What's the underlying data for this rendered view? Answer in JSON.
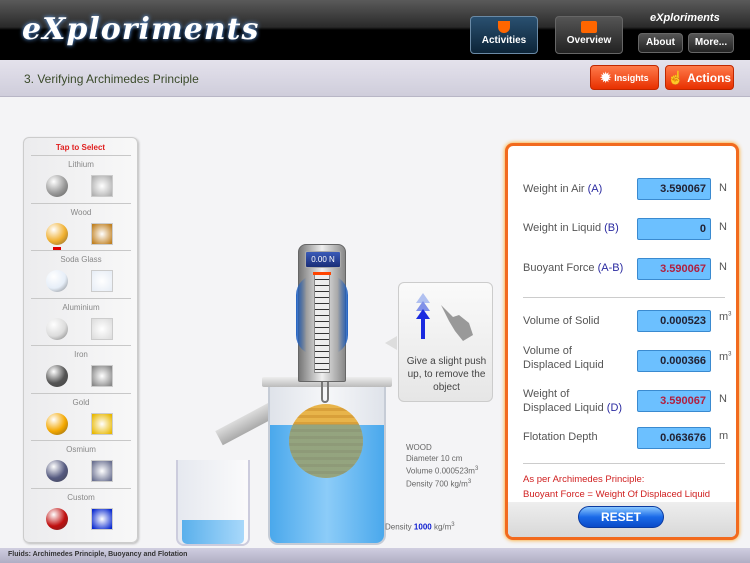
{
  "header": {
    "logo": "eXploriments",
    "brand_small": "eXploriments",
    "activities": "Activities",
    "overview": "Overview",
    "about": "About",
    "more": "More..."
  },
  "subheader": {
    "title": "3. Verifying Archimedes Principle",
    "insights": "Insights",
    "actions": "Actions"
  },
  "materials": {
    "title": "Tap to Select",
    "selected": "Wood",
    "items": [
      {
        "label": "Lithium",
        "sphere": "#9a9a9a",
        "cube": "#b0b0b0"
      },
      {
        "label": "Wood",
        "sphere": "#f0b030",
        "cube": "#c08020"
      },
      {
        "label": "Soda Glass",
        "sphere": "#e6eef8",
        "cube": "#e8eef6"
      },
      {
        "label": "Aluminium",
        "sphere": "#dcdcdc",
        "cube": "#dedede"
      },
      {
        "label": "Iron",
        "sphere": "#555555",
        "cube": "#888888"
      },
      {
        "label": "Gold",
        "sphere": "#f4a800",
        "cube": "#e8b800"
      },
      {
        "label": "Osmium",
        "sphere": "#555a80",
        "cube": "#6a7090"
      },
      {
        "label": "Custom",
        "sphere": "#c01010",
        "cube": "#0a2ad0"
      }
    ]
  },
  "apparatus": {
    "scale_reading": "0.00 N",
    "hint": "Give a slight push up, to remove the object",
    "object": {
      "name": "WOOD",
      "diameter": "Diameter 10 cm",
      "volume": "Volume 0.000523",
      "volume_unit": "m",
      "density": "Density  700 kg/m"
    },
    "liquid": {
      "label": "Density",
      "value": "1000",
      "unit": "kg/m"
    }
  },
  "results": {
    "weight_air": {
      "label": "Weight in Air",
      "key": "(A)",
      "value": "3.590067",
      "unit": "N"
    },
    "weight_liquid": {
      "label": "Weight in Liquid",
      "key": "(B)",
      "value": "0",
      "unit": "N"
    },
    "buoyant": {
      "label": "Buoyant Force",
      "key": "(A-B)",
      "value": "3.590067",
      "unit": "N"
    },
    "vol_solid": {
      "label": "Volume of Solid",
      "value": "0.000523",
      "unit": "m"
    },
    "vol_displaced": {
      "label1": "Volume of",
      "label2": "Displaced Liquid",
      "value": "0.000366",
      "unit": "m"
    },
    "weight_displaced": {
      "label1": "Weight of",
      "label2": "Displaced Liquid",
      "key": "(D)",
      "value": "3.590067",
      "unit": "N"
    },
    "flotation": {
      "label": "Flotation Depth",
      "value": "0.063676",
      "unit": "m"
    },
    "principle1": "As per Archimedes Principle:",
    "principle2": "Buoyant Force = Weight Of Displaced Liquid",
    "reset": "RESET"
  },
  "footer": "Fluids: Archimedes Principle, Buoyancy and Flotation",
  "colors": {
    "accent_orange": "#f26a1e",
    "value_field": "#6cc0ff",
    "water": "#4aa8ec"
  }
}
